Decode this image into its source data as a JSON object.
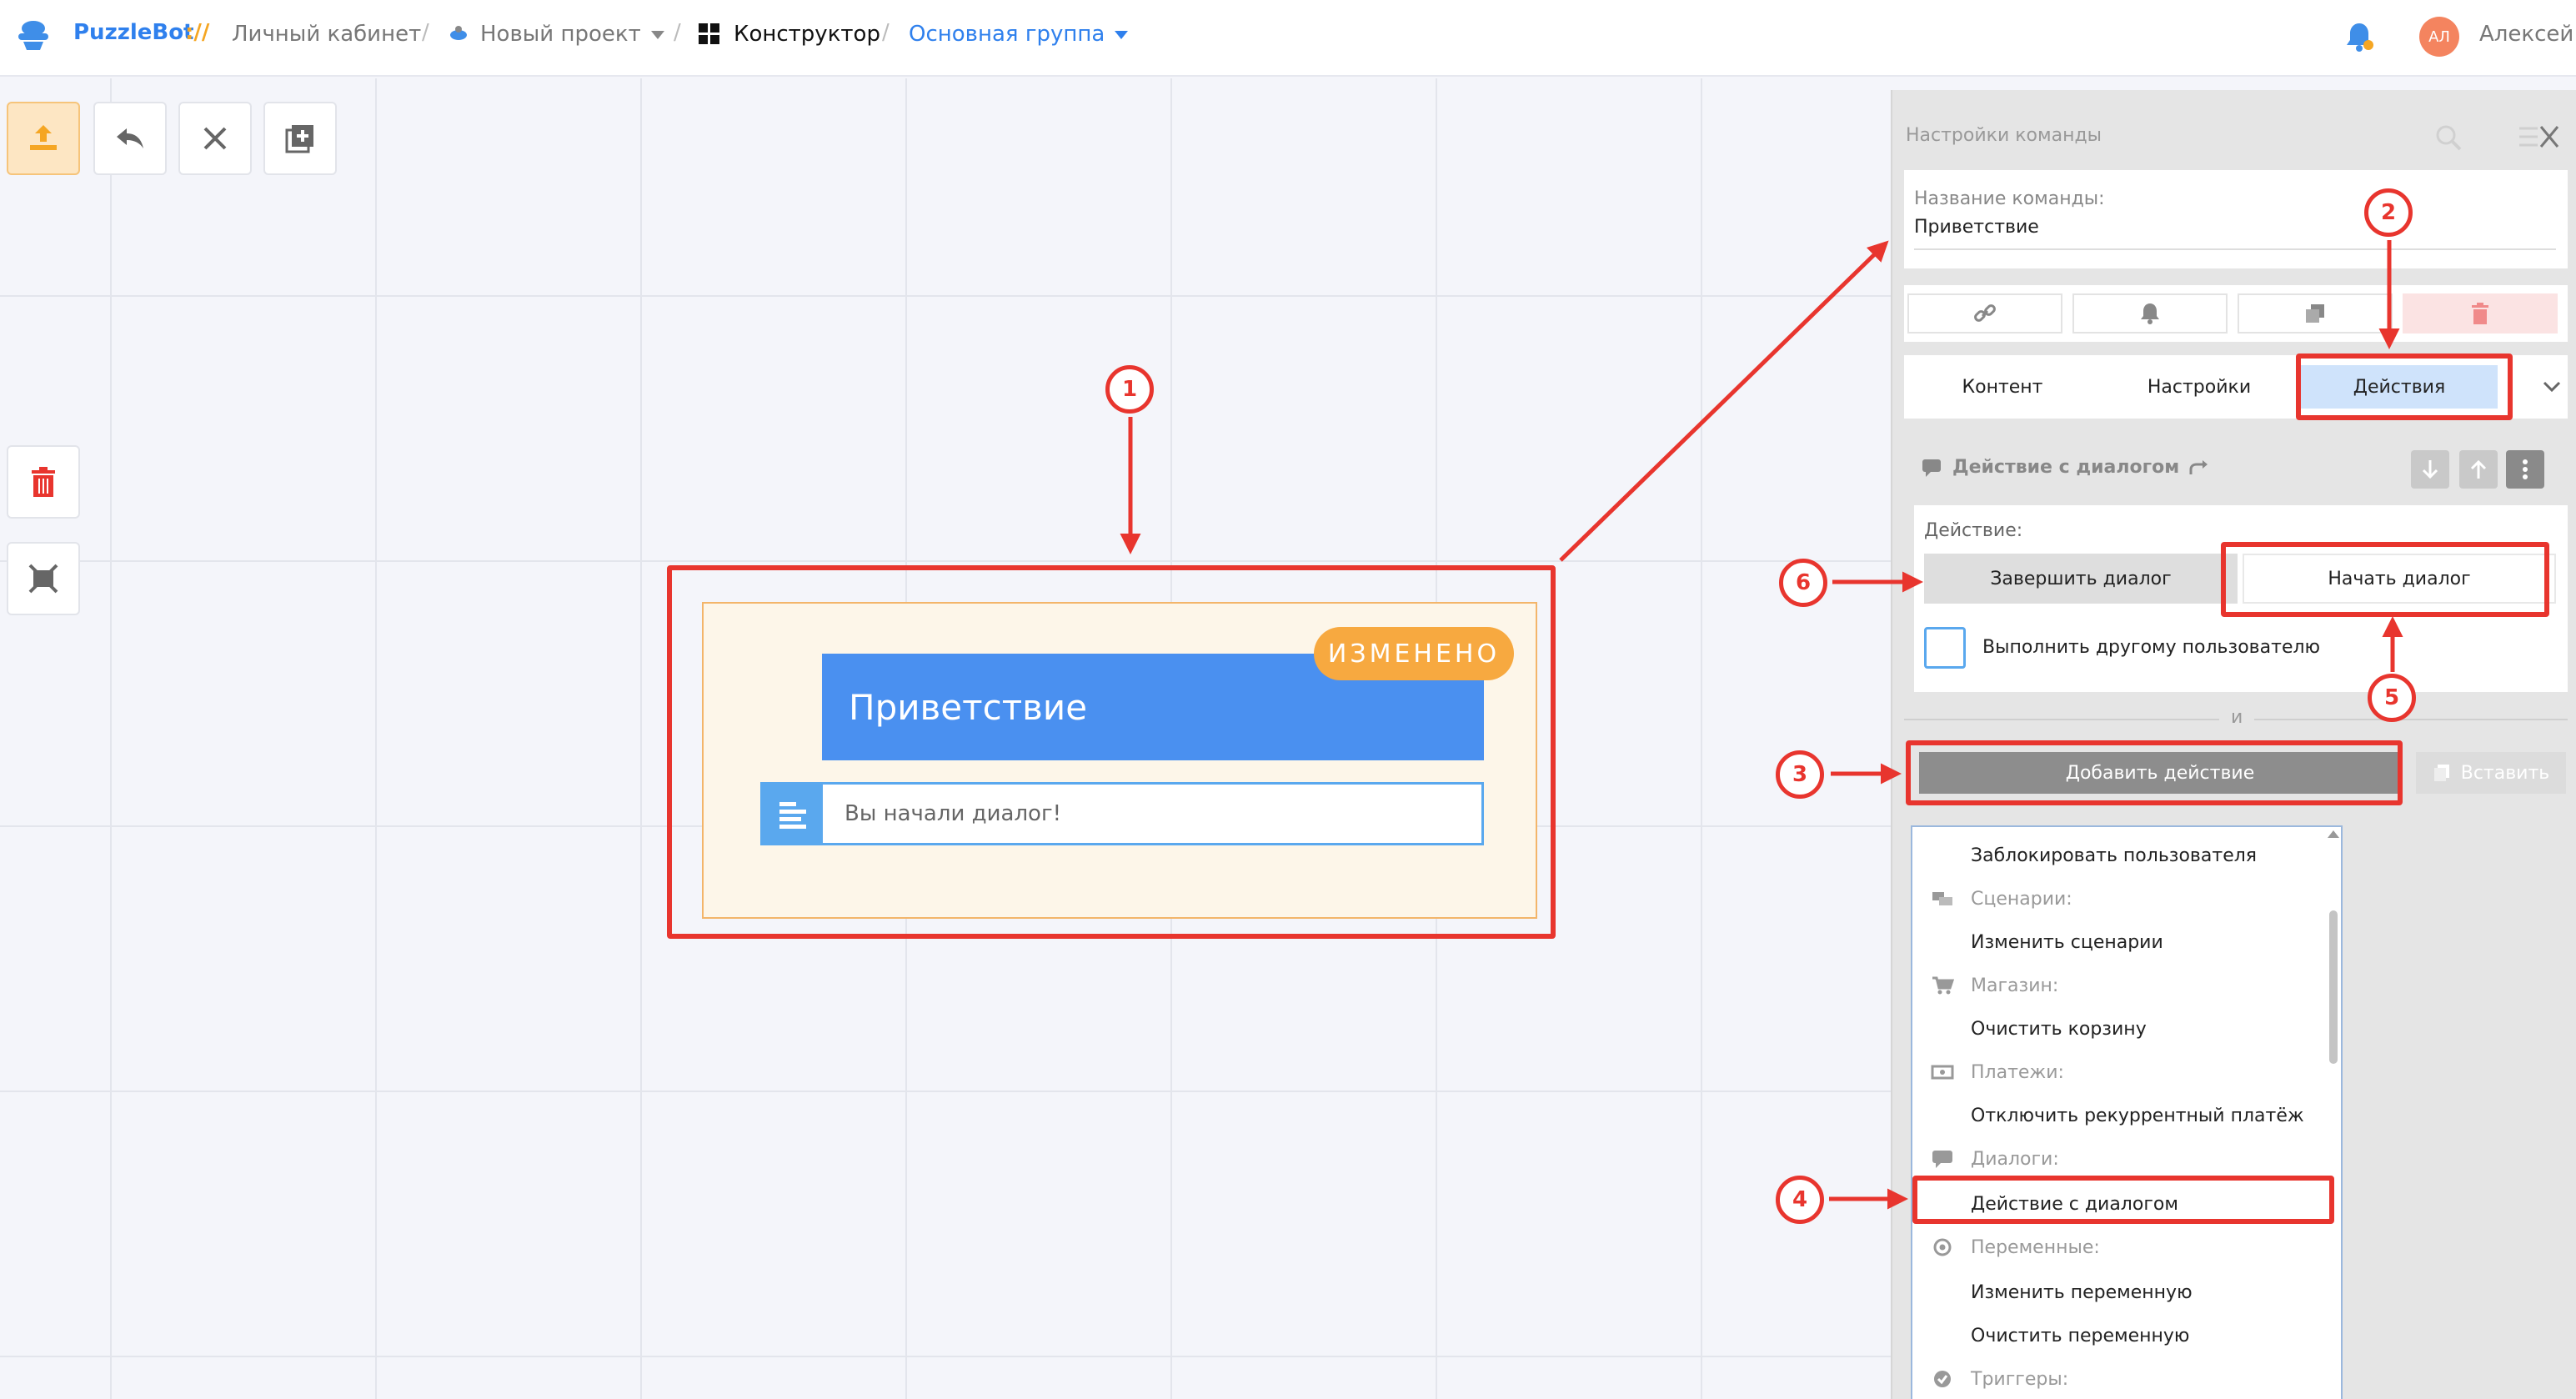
{
  "header": {
    "brand": "PuzzleBot",
    "brand_sep": "://",
    "crumbs": [
      "Личный кабинет",
      "Новый проект",
      "Конструктор",
      "Основная группа"
    ],
    "user_initials": "АЛ",
    "user_name": "Алексей"
  },
  "node": {
    "title": "Приветствие",
    "badge": "ИЗМЕНЕНО",
    "message": "Вы начали диалог!"
  },
  "panel": {
    "title": "Настройки команды",
    "name_label": "Название команды:",
    "name_value": "Приветствие",
    "tabs": [
      "Контент",
      "Настройки",
      "Действия"
    ],
    "section_title": "Действие с диалогом",
    "action_label": "Действие:",
    "end_dialog": "Завершить диалог",
    "start_dialog": "Начать диалог",
    "other_user": "Выполнить другому пользователю",
    "and": "и",
    "add_action": "Добавить действие",
    "paste": "Вставить"
  },
  "dropdown": {
    "items": [
      {
        "type": "item",
        "label": "Заблокировать пользователя"
      },
      {
        "type": "group",
        "label": "Сценарии:",
        "icon": "scenario-icon"
      },
      {
        "type": "item",
        "label": "Изменить сценарии"
      },
      {
        "type": "group",
        "label": "Магазин:",
        "icon": "cart-icon"
      },
      {
        "type": "item",
        "label": "Очистить корзину"
      },
      {
        "type": "group",
        "label": "Платежи:",
        "icon": "payment-icon"
      },
      {
        "type": "item",
        "label": "Отключить рекуррентный платёж"
      },
      {
        "type": "group",
        "label": "Диалоги:",
        "icon": "chat-icon"
      },
      {
        "type": "item",
        "label": "Действие с диалогом"
      },
      {
        "type": "group",
        "label": "Переменные:",
        "icon": "at-icon"
      },
      {
        "type": "item",
        "label": "Изменить переменную"
      },
      {
        "type": "item",
        "label": "Очистить переменную"
      },
      {
        "type": "group",
        "label": "Триггеры:",
        "icon": "trigger-icon"
      }
    ]
  },
  "annotations": [
    "1",
    "2",
    "3",
    "4",
    "5",
    "6"
  ],
  "colors": {
    "accent": "#2f80ed",
    "highlight": "#e8352e",
    "badge": "#f7a940",
    "node_title": "#4a90f0"
  }
}
